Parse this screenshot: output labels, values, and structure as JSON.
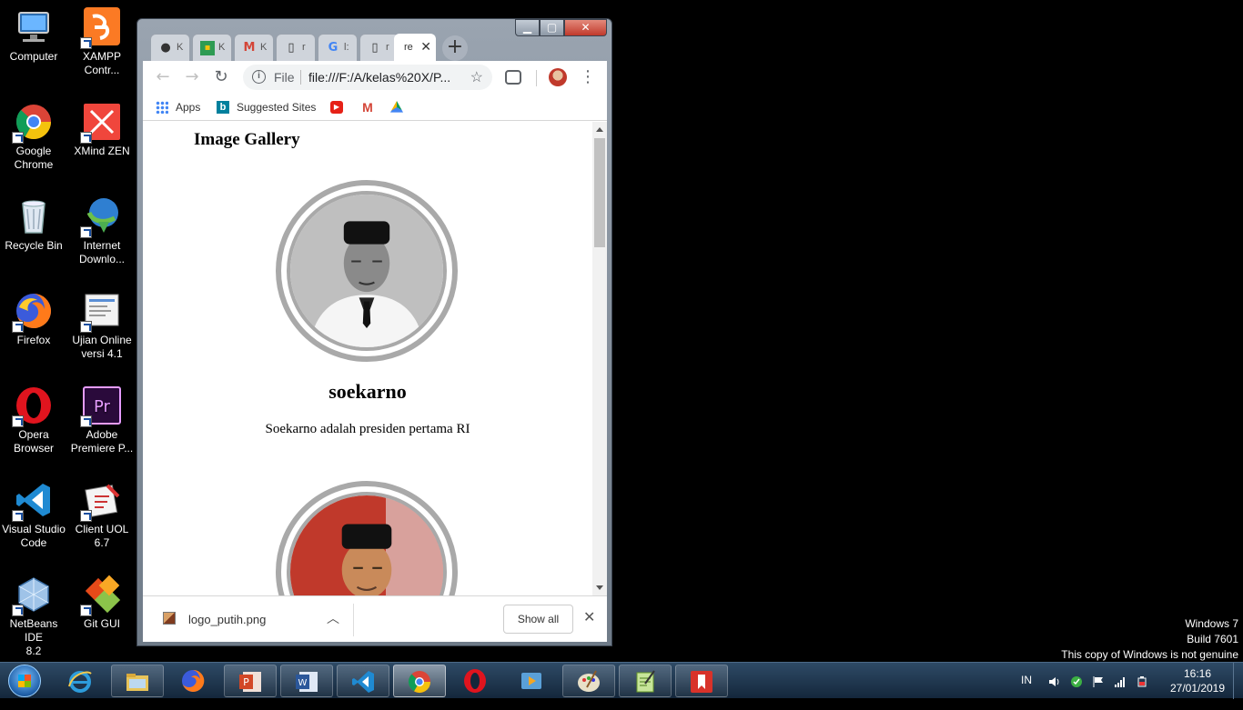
{
  "desktop": {
    "icons": [
      {
        "label_1": "Computer",
        "label_2": ""
      },
      {
        "label_1": "XAMPP",
        "label_2": "Contr..."
      },
      {
        "label_1": "Google",
        "label_2": "Chrome"
      },
      {
        "label_1": "XMind ZEN",
        "label_2": ""
      },
      {
        "label_1": "Recycle Bin",
        "label_2": ""
      },
      {
        "label_1": "Internet",
        "label_2": "Downlo..."
      },
      {
        "label_1": "Firefox",
        "label_2": ""
      },
      {
        "label_1": "Ujian Online",
        "label_2": "versi 4.1"
      },
      {
        "label_1": "Opera",
        "label_2": "Browser"
      },
      {
        "label_1": "Adobe",
        "label_2": "Premiere P..."
      },
      {
        "label_1": "Visual Studio",
        "label_2": "Code"
      },
      {
        "label_1": "Client UOL",
        "label_2": "6.7"
      },
      {
        "label_1": "NetBeans IDE",
        "label_2": "8.2"
      },
      {
        "label_1": "Git GUI",
        "label_2": ""
      }
    ],
    "watermark": {
      "line1": "Windows 7",
      "line2": "Build 7601",
      "line3": "This copy of Windows is not genuine"
    }
  },
  "browser": {
    "tabs": [
      {
        "title": "K",
        "icon": "github-icon"
      },
      {
        "title": "K",
        "icon": "classroom-icon"
      },
      {
        "title": "K",
        "icon": "gmail-icon"
      },
      {
        "title": "r",
        "icon": "document-icon"
      },
      {
        "title": "l:",
        "icon": "google-icon"
      },
      {
        "title": "r",
        "icon": "document-icon"
      },
      {
        "title": "re",
        "icon": "",
        "active": true
      }
    ],
    "new_tab": "+",
    "omnibox": {
      "scheme_label": "File",
      "url": "file:///F:/A/kelas%20X/P..."
    },
    "bookmarks": {
      "apps": "Apps",
      "suggested": "Suggested Sites"
    },
    "page": {
      "title": "Image Gallery",
      "people": [
        {
          "name": "soekarno",
          "description": "Soekarno adalah presiden pertama RI"
        },
        {
          "name": "",
          "description": ""
        }
      ]
    },
    "download_bar": {
      "filename": "logo_putih.png",
      "show_all": "Show all"
    }
  },
  "taskbar": {
    "language": "IN",
    "time": "16:16",
    "date": "27/01/2019",
    "apps": [
      "internet-explorer",
      "file-explorer",
      "firefox",
      "powerpoint",
      "word",
      "vscode",
      "chrome",
      "opera",
      "media",
      "paint",
      "notepad-plus",
      "pdf-reader"
    ]
  },
  "colors": {
    "portrait_ring": "#a9a9a9",
    "taskbar": "#1e3650"
  }
}
